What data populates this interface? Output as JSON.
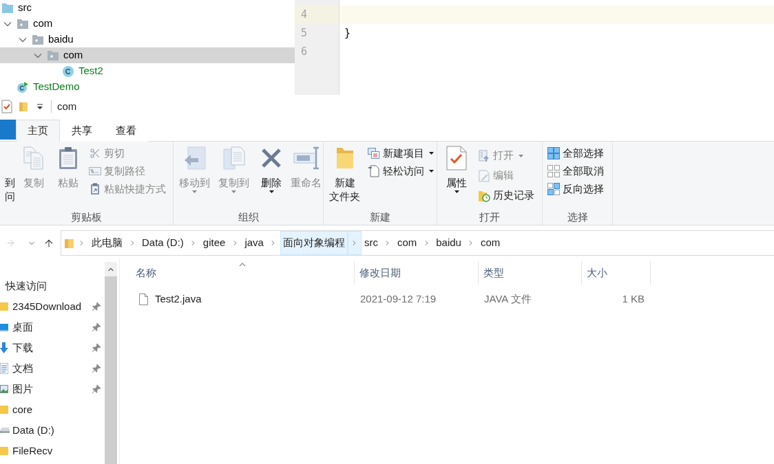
{
  "ide": {
    "project_tree": [
      {
        "label": "src",
        "kind": "source_folder",
        "selected": false,
        "color": "#000000",
        "children": [
          {
            "label": "com",
            "kind": "package",
            "selected": false,
            "expanded": true,
            "color": "#000000",
            "children": [
              {
                "label": "baidu",
                "kind": "package",
                "selected": false,
                "expanded": true,
                "color": "#000000",
                "children": [
                  {
                    "label": "com",
                    "kind": "package",
                    "selected": true,
                    "expanded": true,
                    "color": "#000000",
                    "children": [
                      {
                        "label": "Test2",
                        "kind": "class",
                        "selected": false,
                        "color": "#0a7d1a"
                      }
                    ]
                  }
                ]
              }
            ]
          },
          {
            "label": "TestDemo",
            "kind": "runnable_class",
            "selected": false,
            "color": "#0a7d1a"
          }
        ]
      }
    ],
    "editor": {
      "lines": [
        {
          "number": "4",
          "current": true
        },
        {
          "number": "5",
          "text": "}",
          "current": false
        },
        {
          "number": "6",
          "current": false
        }
      ]
    }
  },
  "explorer": {
    "title_bar": {
      "title": "com"
    },
    "ribbon_tabs": [
      {
        "label": "主页",
        "selected": true
      },
      {
        "label": "共享",
        "selected": false
      },
      {
        "label": "查看",
        "selected": false
      }
    ],
    "ribbon_groups": [
      {
        "label": "剪贴板",
        "items": [
          {
            "kind": "large",
            "lines": [
              "到",
              "问"
            ],
            "disabled": false
          },
          {
            "kind": "large",
            "lines": [
              "复制"
            ],
            "disabled": true
          },
          {
            "kind": "large",
            "lines": [
              "粘贴"
            ],
            "disabled": true
          },
          {
            "kind": "stack",
            "items": [
              {
                "label": "剪切",
                "disabled": true
              },
              {
                "label": "复制路径",
                "disabled": true
              },
              {
                "label": "粘贴快捷方式",
                "disabled": true
              }
            ]
          }
        ]
      },
      {
        "label": "组织",
        "items": [
          {
            "kind": "large",
            "lines": [
              "移动到"
            ],
            "disabled": true,
            "dropdown": true
          },
          {
            "kind": "large",
            "lines": [
              "复制到"
            ],
            "disabled": true,
            "dropdown": true
          },
          {
            "kind": "separator"
          },
          {
            "kind": "large",
            "lines": [
              "删除"
            ],
            "disabled": false,
            "dropdown": true
          },
          {
            "kind": "large",
            "lines": [
              "重命名"
            ],
            "disabled": true
          }
        ]
      },
      {
        "label": "新建",
        "items": [
          {
            "kind": "large",
            "lines": [
              "新建",
              "文件夹"
            ],
            "disabled": false
          },
          {
            "kind": "stack",
            "items": [
              {
                "label": "新建项目",
                "disabled": false,
                "dropdown": true
              },
              {
                "label": "轻松访问",
                "disabled": false,
                "dropdown": true
              }
            ]
          }
        ]
      },
      {
        "label": "打开",
        "items": [
          {
            "kind": "large",
            "lines": [
              "属性"
            ],
            "disabled": false,
            "dropdown": true
          },
          {
            "kind": "stack",
            "items": [
              {
                "label": "打开",
                "disabled": true,
                "dropdown": true
              },
              {
                "label": "编辑",
                "disabled": true
              },
              {
                "label": "历史记录",
                "disabled": false
              }
            ]
          }
        ]
      },
      {
        "label": "选择",
        "items": [
          {
            "kind": "stack",
            "items": [
              {
                "label": "全部选择",
                "disabled": false
              },
              {
                "label": "全部取消",
                "disabled": false
              },
              {
                "label": "反向选择",
                "disabled": false
              }
            ]
          }
        ]
      }
    ],
    "address_bar": {
      "forward_disabled": true,
      "crumbs": [
        {
          "label": "此电脑",
          "highlighted": false
        },
        {
          "label": "Data (D:)",
          "highlighted": false
        },
        {
          "label": "gitee",
          "highlighted": false
        },
        {
          "label": "java",
          "highlighted": false
        },
        {
          "label": "面向对象编程",
          "highlighted": true
        },
        {
          "label": "src",
          "highlighted": false
        },
        {
          "label": "com",
          "highlighted": false
        },
        {
          "label": "baidu",
          "highlighted": false
        },
        {
          "label": "com",
          "highlighted": false
        }
      ]
    },
    "navigation_pane": {
      "items": [
        {
          "label": "快速访问",
          "children": [
            {
              "label": "2345Download",
              "pinned": true
            },
            {
              "label": "桌面",
              "pinned": true
            },
            {
              "label": "下载",
              "pinned": true
            },
            {
              "label": "文档",
              "pinned": true
            },
            {
              "label": "图片",
              "pinned": true
            },
            {
              "label": "core"
            },
            {
              "label": "Data (D:)"
            },
            {
              "label": "FileRecv"
            }
          ]
        }
      ]
    },
    "file_list": {
      "columns": [
        {
          "label": "名称",
          "sorted": true
        },
        {
          "label": "修改日期",
          "sorted": false
        },
        {
          "label": "类型",
          "sorted": false
        },
        {
          "label": "大小",
          "sorted": false
        }
      ],
      "rows": [
        {
          "name": "Test2.java",
          "modified": "2021-09-12 7:19",
          "type": "JAVA 文件",
          "size": "1 KB"
        }
      ]
    }
  }
}
